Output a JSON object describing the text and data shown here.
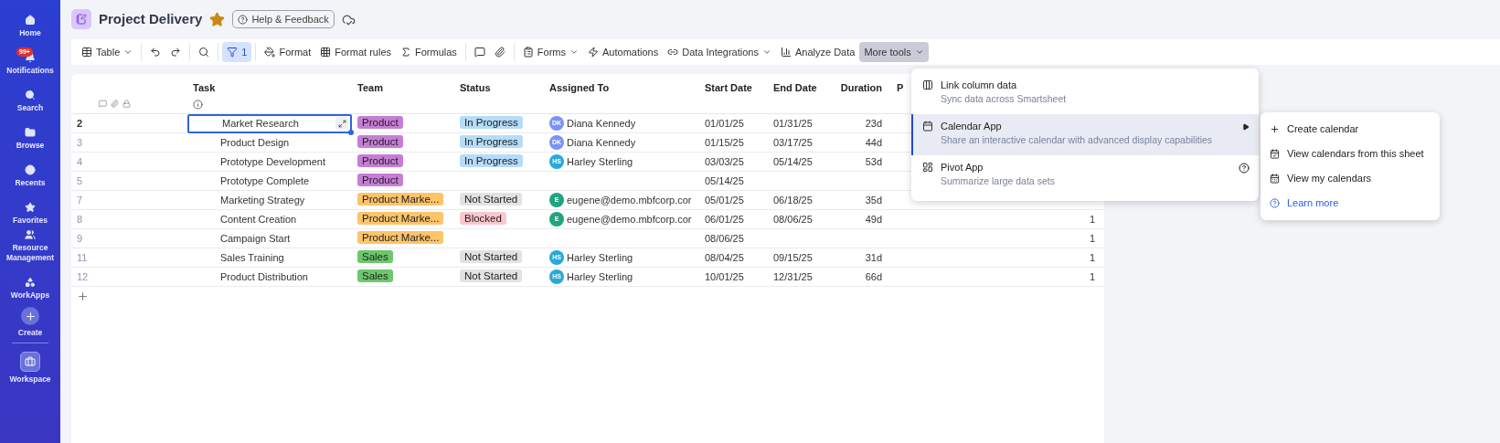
{
  "sidebar": {
    "items": [
      {
        "label": "Home"
      },
      {
        "label": "Notifications",
        "badge": "99+"
      },
      {
        "label": "Search"
      },
      {
        "label": "Browse"
      },
      {
        "label": "Recents"
      },
      {
        "label": "Favorites"
      },
      {
        "label": "Resource Management"
      },
      {
        "label": "WorkApps"
      },
      {
        "label": "Create"
      },
      {
        "label": "Workspace"
      }
    ]
  },
  "header": {
    "title": "Project Delivery",
    "favorite": true,
    "help_button": "Help & Feedback"
  },
  "toolbar": {
    "items": [
      {
        "label": "Table",
        "dropdown": true,
        "selected": false
      },
      {
        "dropdown": false,
        "selected": false
      },
      {
        "dropdown": false,
        "selected": false
      },
      {
        "dropdown": false,
        "selected": false
      },
      {
        "label": "1",
        "dropdown": false,
        "selected": true
      },
      {
        "label": "Format",
        "dropdown": false,
        "selected": false
      },
      {
        "label": "Format rules",
        "dropdown": false,
        "selected": false
      },
      {
        "label": "Formulas",
        "dropdown": false,
        "selected": false
      },
      {
        "dropdown": false,
        "selected": false
      },
      {
        "dropdown": false,
        "selected": false
      },
      {
        "label": "Forms",
        "dropdown": true,
        "selected": false
      },
      {
        "label": "Automations",
        "dropdown": false,
        "selected": false
      },
      {
        "label": "Data Integrations",
        "dropdown": true,
        "selected": false
      },
      {
        "label": "Analyze Data",
        "dropdown": false,
        "selected": false
      },
      {
        "label": "More tools",
        "dropdown": true,
        "selected": true
      }
    ]
  },
  "table": {
    "columns": [
      "Task",
      "Team",
      "Status",
      "Assigned To",
      "Start Date",
      "End Date",
      "Duration",
      "P"
    ],
    "rows": [
      {
        "number": "2",
        "selected": true,
        "task": "Market Research",
        "team": {
          "label": "Product",
          "color": "#c77dd6"
        },
        "status": {
          "label": "In Progress",
          "color": "#b5dcf9"
        },
        "assignee": {
          "initials": "DK",
          "name": "Diana Kennedy",
          "color": "#7b93f7"
        },
        "start": "01/01/25",
        "end": "01/31/25",
        "duration": "23d"
      },
      {
        "number": "3",
        "selected": false,
        "task": "Product Design",
        "team": {
          "label": "Product",
          "color": "#c77dd6"
        },
        "status": {
          "label": "In Progress",
          "color": "#b5dcf9"
        },
        "assignee": {
          "initials": "DK",
          "name": "Diana Kennedy",
          "color": "#7b93f7"
        },
        "start": "01/15/25",
        "end": "03/17/25",
        "duration": "44d"
      },
      {
        "number": "4",
        "selected": false,
        "task": "Prototype Development",
        "team": {
          "label": "Product",
          "color": "#c77dd6"
        },
        "status": {
          "label": "In Progress",
          "color": "#b5dcf9"
        },
        "assignee": {
          "initials": "HS",
          "name": "Harley Sterling",
          "color": "#2aa9d6"
        },
        "start": "03/03/25",
        "end": "05/14/25",
        "duration": "53d"
      },
      {
        "number": "5",
        "selected": false,
        "task": "Prototype Complete",
        "team": {
          "label": "Product",
          "color": "#c77dd6"
        },
        "start": "05/14/25"
      },
      {
        "number": "7",
        "selected": false,
        "task": "Marketing Strategy",
        "team": {
          "label": "Product Marke...",
          "color": "#fdc46a"
        },
        "status": {
          "label": "Not Started",
          "color": "#e2e2e2"
        },
        "assignee": {
          "initials": "E",
          "name": "eugene@demo.mbfcorp.cor",
          "color": "#20a47f"
        },
        "start": "05/01/25",
        "end": "06/18/25",
        "duration": "35d"
      },
      {
        "number": "8",
        "selected": false,
        "task": "Content Creation",
        "team": {
          "label": "Product Marke...",
          "color": "#fdc46a"
        },
        "status": {
          "label": "Blocked",
          "color": "#fbc6ce"
        },
        "assignee": {
          "initials": "E",
          "name": "eugene@demo.mbfcorp.cor",
          "color": "#20a47f"
        },
        "start": "06/01/25",
        "end": "08/06/25",
        "duration": "49d",
        "column_9": "1"
      },
      {
        "number": "9",
        "selected": false,
        "task": "Campaign Start",
        "team": {
          "label": "Product Marke...",
          "color": "#fdc46a"
        },
        "start": "08/06/25",
        "column_9": "1"
      },
      {
        "number": "11",
        "selected": false,
        "task": "Sales Training",
        "team": {
          "label": "Sales",
          "color": "#6cc76d"
        },
        "status": {
          "label": "Not Started",
          "color": "#e2e2e2"
        },
        "assignee": {
          "initials": "HS",
          "name": "Harley Sterling",
          "color": "#2aa9d6"
        },
        "start": "08/04/25",
        "end": "09/15/25",
        "duration": "31d",
        "column_9": "1"
      },
      {
        "number": "12",
        "selected": false,
        "task": "Product Distribution",
        "team": {
          "label": "Sales",
          "color": "#6cc76d"
        },
        "status": {
          "label": "Not Started",
          "color": "#e2e2e2"
        },
        "assignee": {
          "initials": "HS",
          "name": "Harley Sterling",
          "color": "#2aa9d6"
        },
        "start": "10/01/25",
        "end": "12/31/25",
        "duration": "66d",
        "column_9": "1"
      }
    ]
  },
  "menu": {
    "items": [
      {
        "title": "Link column data",
        "subtitle": "Sync data across Smartsheet",
        "selected": false,
        "submenu": false,
        "help": false
      },
      {
        "title": "Calendar App",
        "subtitle": "Share an interactive calendar with advanced display capabilities",
        "selected": true,
        "submenu": true,
        "help": false
      },
      {
        "title": "Pivot App",
        "subtitle": "Summarize large data sets",
        "selected": false,
        "submenu": false,
        "help": true
      }
    ]
  },
  "submenu": {
    "items": [
      {
        "label": "Create calendar",
        "kind": "action"
      },
      {
        "label": "View calendars from this sheet",
        "kind": "action"
      },
      {
        "label": "View my calendars",
        "kind": "action"
      },
      {
        "label": "Learn more",
        "kind": "link"
      }
    ]
  }
}
